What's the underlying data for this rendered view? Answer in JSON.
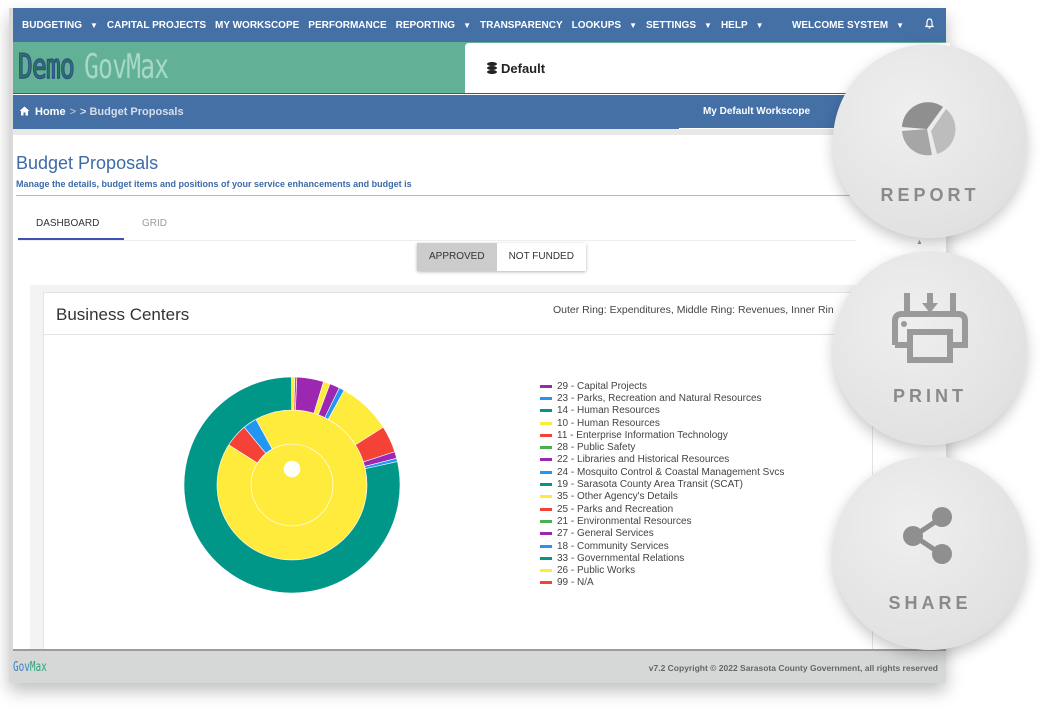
{
  "topnav": {
    "items": [
      {
        "label": "BUDGETING",
        "dropdown": true
      },
      {
        "label": "CAPITAL PROJECTS",
        "dropdown": false
      },
      {
        "label": "MY WORKSCOPE",
        "dropdown": false
      },
      {
        "label": "PERFORMANCE",
        "dropdown": false
      },
      {
        "label": "REPORTING",
        "dropdown": true
      },
      {
        "label": "TRANSPARENCY",
        "dropdown": false
      },
      {
        "label": "LOOKUPS",
        "dropdown": true
      },
      {
        "label": "SETTINGS",
        "dropdown": true
      },
      {
        "label": "HELP",
        "dropdown": true
      }
    ],
    "user_label": "WELCOME SYSTEM",
    "caret": "▼",
    "bell_icon": "bell-icon"
  },
  "logo": {
    "demo": "Demo",
    "brand": "GovMax"
  },
  "workscope": {
    "label": "Default",
    "icon": "database-icon"
  },
  "breadcrumb": {
    "home": "Home",
    "separator": ">",
    "current": "> Budget Proposals",
    "workscope_tab": "My Default Workscope"
  },
  "page": {
    "title": "Budget Proposals",
    "subtitle": "Manage the details, budget items and positions of your service enhancements and budget is"
  },
  "tabs": [
    {
      "label": "DASHBOARD",
      "active": true
    },
    {
      "label": "GRID",
      "active": false
    }
  ],
  "toggle": [
    {
      "label": "APPROVED",
      "selected": true
    },
    {
      "label": "NOT FUNDED",
      "selected": false
    }
  ],
  "panel": {
    "title": "Business Centers",
    "note": "Outer Ring: Expenditures, Middle Ring: Revenues, Inner Rin"
  },
  "chart_data": {
    "type": "sunburst",
    "title": "Business Centers",
    "subtitle": "Outer Ring: Expenditures, Middle Ring: Revenues, Inner Ring",
    "legend_position": "right",
    "legend": [
      {
        "label": "29 - Capital Projects",
        "color": "#9c27b0"
      },
      {
        "label": "23 - Parks, Recreation and Natural Resources",
        "color": "#2196f3"
      },
      {
        "label": "14 - Human Resources",
        "color": "#009688"
      },
      {
        "label": "10 - Human Resources",
        "color": "#ffeb3b"
      },
      {
        "label": "11 - Enterprise Information Technology",
        "color": "#f44336"
      },
      {
        "label": "28 - Public Safety",
        "color": "#4caf50"
      },
      {
        "label": "22 - Libraries and Historical Resources",
        "color": "#9c27b0"
      },
      {
        "label": "24 - Mosquito Control & Coastal Management Svcs",
        "color": "#2196f3"
      },
      {
        "label": "19 - Sarasota County Area Transit (SCAT)",
        "color": "#009688"
      },
      {
        "label": "35 - Other Agency's Details",
        "color": "#ffeb3b"
      },
      {
        "label": "25 - Parks and Recreation",
        "color": "#f44336"
      },
      {
        "label": "21 - Environmental Resources",
        "color": "#4caf50"
      },
      {
        "label": "27 - General Services",
        "color": "#9c27b0"
      },
      {
        "label": "18 - Community Services",
        "color": "#2196f3"
      },
      {
        "label": "33 - Governmental Relations",
        "color": "#009688"
      },
      {
        "label": "26 - Public Works",
        "color": "#ffeb3b"
      },
      {
        "label": "99 - N/A",
        "color": "#f44336"
      }
    ],
    "rings": [
      {
        "name": "Inner Ring",
        "segments": [
          {
            "color": "#ffeb3b",
            "value": 100
          }
        ]
      },
      {
        "name": "Middle Ring: Revenues",
        "segments": [
          {
            "color": "#ffeb3b",
            "value": 92
          },
          {
            "color": "#f44336",
            "value": 5
          },
          {
            "color": "#2196f3",
            "value": 3
          }
        ]
      },
      {
        "name": "Outer Ring: Expenditures",
        "segments": [
          {
            "color": "#ffeb3b",
            "value": 0.5
          },
          {
            "color": "#f44336",
            "value": 0.3
          },
          {
            "color": "#9c27b0",
            "value": 4
          },
          {
            "color": "#ffeb3b",
            "value": 1
          },
          {
            "color": "#9c27b0",
            "value": 1.5
          },
          {
            "color": "#2196f3",
            "value": 0.8
          },
          {
            "color": "#ffeb3b",
            "value": 8
          },
          {
            "color": "#f44336",
            "value": 4
          },
          {
            "color": "#9c27b0",
            "value": 1
          },
          {
            "color": "#2196f3",
            "value": 0.5
          },
          {
            "color": "#009688",
            "value": 78.4
          }
        ]
      }
    ]
  },
  "footer": {
    "logo_g": "Gov",
    "logo_m": "Max",
    "copyright": "v7.2 Copyright © 2022 Sarasota County Government, all rights reserved"
  },
  "actions": [
    {
      "label": "REPORT",
      "icon": "pie-chart-icon"
    },
    {
      "label": "PRINT",
      "icon": "printer-icon"
    },
    {
      "label": "SHARE",
      "icon": "share-icon"
    }
  ]
}
